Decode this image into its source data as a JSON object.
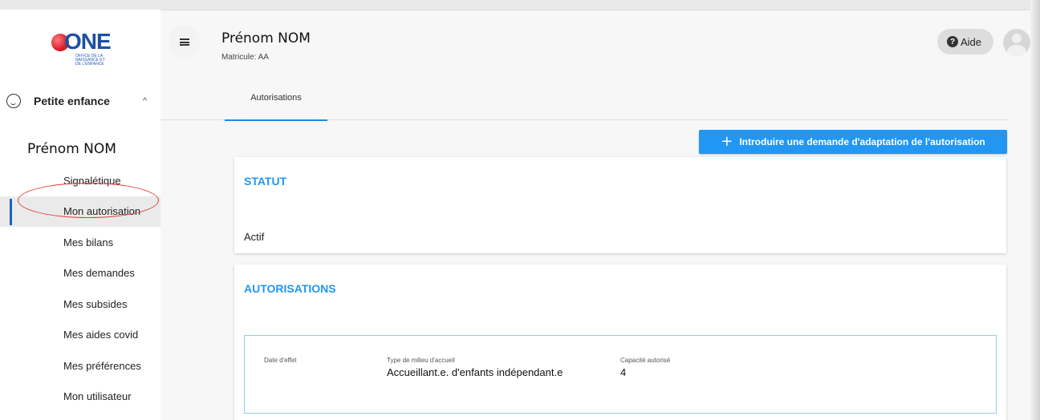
{
  "brand": {
    "logo_text": "ONE",
    "logo_subtitle": "OFFICE DE LA NAISSANCE ET DE L'ENFANCE"
  },
  "sidebar": {
    "section_label": "Petite enfance",
    "person_name": "Prénom NOM",
    "items": [
      {
        "label": "Signalétique"
      },
      {
        "label": "Mon autorisation",
        "active": true
      },
      {
        "label": "Mes bilans"
      },
      {
        "label": "Mes demandes"
      },
      {
        "label": "Mes subsides"
      },
      {
        "label": "Mes aides covid"
      },
      {
        "label": "Mes préférences"
      },
      {
        "label": "Mon utilisateur"
      }
    ]
  },
  "header": {
    "title": "Prénom NOM",
    "subtitle": "Matricule: AA",
    "help_label": "Aide"
  },
  "tabs": [
    {
      "label": "Autorisations",
      "active": true
    }
  ],
  "actions": {
    "primary_label": "Introduire une demande d'adaptation de l'autorisation"
  },
  "statut": {
    "title": "STATUT",
    "value": "Actif"
  },
  "autorisations": {
    "title": "AUTORISATIONS",
    "fields": [
      {
        "label": "Date d'effet",
        "value": ""
      },
      {
        "label": "Type de milieu d'accueil",
        "value": "Accueillant.e. d'enfants indépendant.e"
      },
      {
        "label": "Capacité autorisé",
        "value": "4"
      }
    ]
  },
  "colors": {
    "accent": "#2196f3",
    "active_bar": "#1565c0",
    "highlight_circle": "#e23b3b"
  }
}
